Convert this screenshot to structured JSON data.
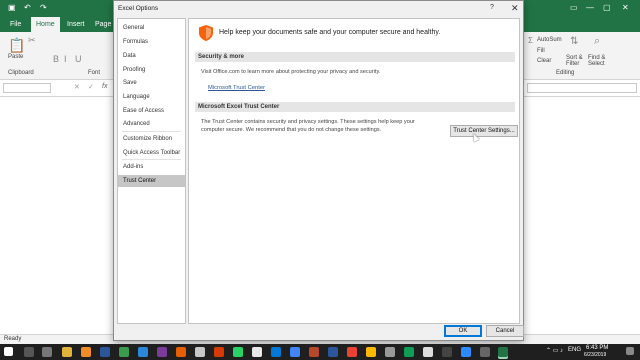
{
  "excel": {
    "tabs": [
      "File",
      "Home",
      "Insert",
      "Page La"
    ],
    "active_tab": "Home",
    "ribbon_groups": [
      "Clipboard",
      "Font",
      "Editing"
    ],
    "ribbon_right": {
      "autosum": "AutoSum",
      "fill": "Fill",
      "clear": "Clear",
      "sort_filter": "Sort & Filter",
      "find_select": "Find & Select"
    },
    "paste_label": "Paste",
    "font_buttons": [
      "B",
      "I",
      "U"
    ],
    "formula_fx": "fx",
    "status": "Ready"
  },
  "dialog": {
    "title": "Excel Options",
    "help": "?",
    "close": "✕",
    "nav": [
      "General",
      "Formulas",
      "Data",
      "Proofing",
      "Save",
      "Language",
      "Ease of Access",
      "Advanced",
      "Customize Ribbon",
      "Quick Access Toolbar",
      "Add-ins",
      "Trust Center"
    ],
    "selected_nav": "Trust Center",
    "hero_text": "Help keep your documents safe and your computer secure and healthy.",
    "security_section": {
      "heading": "Security & more",
      "body": "Visit Office.com to learn more about protecting your privacy and security.",
      "link": "Microsoft Trust Center"
    },
    "trust_section": {
      "heading": "Microsoft Excel Trust Center",
      "body_line1": "The Trust Center contains security and privacy settings. These settings help keep your",
      "body_line2": "computer secure. We recommend that you do not change these settings.",
      "button": "Trust Center Settings..."
    },
    "ok": "OK",
    "cancel": "Cancel"
  },
  "taskbar": {
    "language": "ENG",
    "time": "6:43 PM",
    "date": "6/23/2019"
  },
  "colors": {
    "excel_green": "#217346",
    "selected_nav": "#c6c6c6",
    "link": "#2b5797",
    "shield": "#f7630c"
  }
}
